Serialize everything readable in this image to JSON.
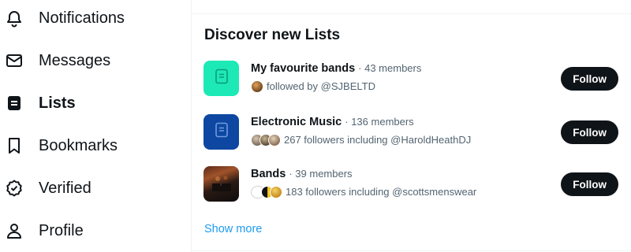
{
  "sidebar": {
    "items": [
      {
        "label": "Notifications",
        "icon": "bell-icon"
      },
      {
        "label": "Messages",
        "icon": "envelope-icon"
      },
      {
        "label": "Lists",
        "icon": "lists-icon",
        "active": true
      },
      {
        "label": "Bookmarks",
        "icon": "bookmark-icon"
      },
      {
        "label": "Verified",
        "icon": "verified-badge-icon"
      },
      {
        "label": "Profile",
        "icon": "person-icon"
      }
    ]
  },
  "discover": {
    "title": "Discover new Lists",
    "lists": [
      {
        "name": "My favourite bands",
        "members": "· 43 members",
        "subtitle": "followed by @SJBELTD",
        "follow_label": "Follow",
        "thumb_color": "#1de9b6",
        "thumb_icon": "list-doc-icon"
      },
      {
        "name": "Electronic Music",
        "members": "· 136 members",
        "subtitle": "267 followers including @HaroldHeathDJ",
        "follow_label": "Follow",
        "thumb_color": "#0d47a1",
        "thumb_icon": "list-doc-icon"
      },
      {
        "name": "Bands",
        "members": "· 39 members",
        "subtitle": "183 followers including @scottsmenswear",
        "follow_label": "Follow",
        "thumb_icon": "concert-photo"
      }
    ],
    "show_more": "Show more"
  },
  "colors": {
    "text_primary": "#0f1419",
    "text_secondary": "#536471",
    "link": "#1d9bf0",
    "button_bg": "#0f1419",
    "divider": "#eff3f4"
  }
}
